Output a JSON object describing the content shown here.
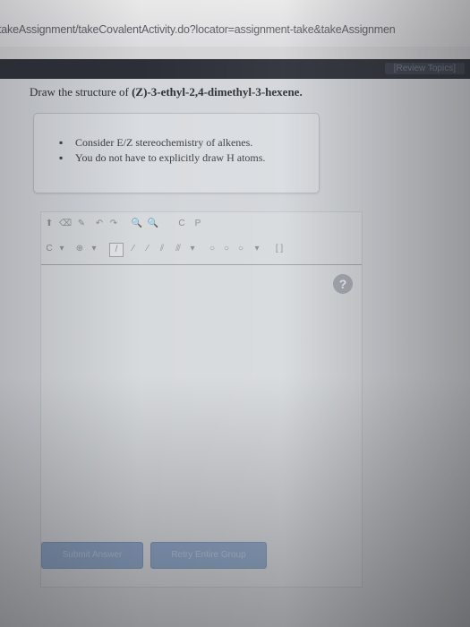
{
  "browser": {
    "url": "takeAssignment/takeCovalentActivity.do?locator=assignment-take&takeAssignmen"
  },
  "nav": {
    "review_link": "[Review Topics]"
  },
  "question": {
    "prefix": "Draw the structure of ",
    "compound": "(Z)-3-ethyl-2,4-dimethyl-3-hexene."
  },
  "hints": [
    "Consider E/Z stereochemistry of alkenes.",
    "You do not have to explicitly draw H atoms."
  ],
  "hint_bullet": "▪",
  "editor": {
    "toolbar_row1": [
      {
        "icon": "select-icon",
        "glyph": "⬆"
      },
      {
        "icon": "eraser-icon",
        "glyph": "⌫"
      },
      {
        "icon": "pencil-icon",
        "glyph": "✎"
      },
      {
        "icon": "lasso-icon",
        "glyph": "↶"
      },
      {
        "icon": "arrow-icon",
        "glyph": "↷"
      },
      {
        "icon": "zoom-in-icon",
        "glyph": "🔍"
      },
      {
        "icon": "zoom-out-icon",
        "glyph": "🔍"
      },
      {
        "icon": "c-atom-icon",
        "glyph": "C"
      },
      {
        "icon": "p-atom-icon",
        "glyph": "P"
      }
    ],
    "toolbar_row2": [
      {
        "icon": "carbon-select-icon",
        "glyph": "C"
      },
      {
        "icon": "dropdown-arrow-icon",
        "glyph": "▾"
      },
      {
        "icon": "charge-icon",
        "glyph": "⊕"
      },
      {
        "icon": "dropdown-arrow-icon",
        "glyph": "▾"
      },
      {
        "icon": "single-bond-icon",
        "glyph": "/"
      },
      {
        "icon": "wedge-bond-icon",
        "glyph": "⁄"
      },
      {
        "icon": "hash-bond-icon",
        "glyph": "⁄"
      },
      {
        "icon": "double-bond-icon",
        "glyph": "⫽"
      },
      {
        "icon": "triple-bond-icon",
        "glyph": "⫻"
      },
      {
        "icon": "dropdown-arrow-icon",
        "glyph": "▾"
      },
      {
        "icon": "ring-cyclopropane-icon",
        "glyph": "○"
      },
      {
        "icon": "ring-cyclobutane-icon",
        "glyph": "○"
      },
      {
        "icon": "ring-benzene-icon",
        "glyph": "○"
      },
      {
        "icon": "dropdown-arrow-icon",
        "glyph": "▾"
      },
      {
        "icon": "bracket-icon",
        "glyph": "[ ]"
      }
    ],
    "help_label": "?"
  },
  "buttons": {
    "submit": "Submit Answer",
    "retry": "Retry Entire Group"
  }
}
